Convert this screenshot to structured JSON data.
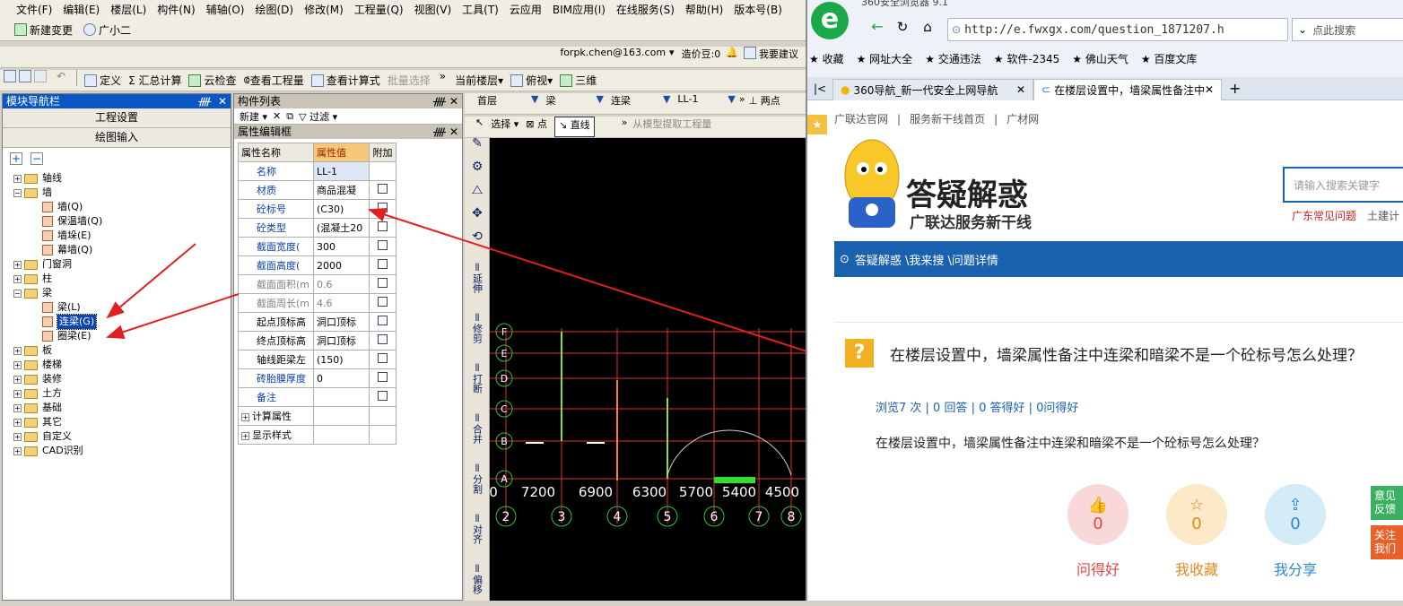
{
  "app": {
    "menu": [
      "文件(F)",
      "编辑(E)",
      "楼层(L)",
      "构件(N)",
      "辅轴(O)",
      "绘图(D)",
      "修改(M)",
      "工程量(Q)",
      "视图(V)",
      "工具(T)",
      "云应用",
      "BIM应用(I)",
      "在线服务(S)",
      "帮助(H)",
      "版本号(B)"
    ],
    "submenu": [
      "新建变更",
      "广小二"
    ],
    "account": {
      "email": "forpk.chen@163.com",
      "price": "造价豆:0",
      "suggest": "我要建议"
    },
    "toolbar1": [
      "定义",
      "Σ 汇总计算",
      "云检查",
      "查看工程量",
      "查看计算式",
      "批量选择",
      "当前楼层",
      "俯视",
      "三维"
    ],
    "nav": {
      "title": "模块导航栏",
      "btn1": "工程设置",
      "btn2": "绘图输入",
      "tree": [
        {
          "label": "轴线",
          "level": 0,
          "exp": "+"
        },
        {
          "label": "墙",
          "level": 0,
          "exp": "-"
        },
        {
          "label": "墙(Q)",
          "level": 1
        },
        {
          "label": "保温墙(Q)",
          "level": 1
        },
        {
          "label": "墙垛(E)",
          "level": 1
        },
        {
          "label": "幕墙(Q)",
          "level": 1
        },
        {
          "label": "门窗洞",
          "level": 0,
          "exp": "+"
        },
        {
          "label": "柱",
          "level": 0,
          "exp": "+"
        },
        {
          "label": "梁",
          "level": 0,
          "exp": "-"
        },
        {
          "label": "梁(L)",
          "level": 1
        },
        {
          "label": "连梁(G)",
          "level": 1,
          "sel": true
        },
        {
          "label": "圈梁(E)",
          "level": 1
        },
        {
          "label": "板",
          "level": 0,
          "exp": "+"
        },
        {
          "label": "楼梯",
          "level": 0,
          "exp": "+"
        },
        {
          "label": "装修",
          "level": 0,
          "exp": "+"
        },
        {
          "label": "土方",
          "level": 0,
          "exp": "+"
        },
        {
          "label": "基础",
          "level": 0,
          "exp": "+"
        },
        {
          "label": "其它",
          "level": 0,
          "exp": "+"
        },
        {
          "label": "自定义",
          "level": 0,
          "exp": "+"
        },
        {
          "label": "CAD识别",
          "level": 0,
          "exp": "+"
        }
      ]
    },
    "complist": {
      "title": "构件列表",
      "new": "新建",
      "filter": "过滤"
    },
    "propeditor": {
      "title": "属性编辑框",
      "headers": [
        "属性名称",
        "属性值",
        "附加"
      ],
      "rows": [
        {
          "n": "名称",
          "v": "LL-1",
          "cb": false,
          "kind": "blue"
        },
        {
          "n": "材质",
          "v": "商品混凝",
          "cb": true,
          "kind": "blue"
        },
        {
          "n": "砼标号",
          "v": "(C30)",
          "cb": true,
          "kind": "blue"
        },
        {
          "n": "砼类型",
          "v": "(混凝土20",
          "cb": true,
          "kind": "blue"
        },
        {
          "n": "截面宽度(",
          "v": "300",
          "cb": true,
          "kind": "blue"
        },
        {
          "n": "截面高度(",
          "v": "2000",
          "cb": true,
          "kind": "blue"
        },
        {
          "n": "截面面积(m",
          "v": "0.6",
          "cb": true,
          "kind": "dim"
        },
        {
          "n": "截面周长(m",
          "v": "4.6",
          "cb": true,
          "kind": "dim"
        },
        {
          "n": "起点顶标高",
          "v": "洞口顶标",
          "cb": true,
          "kind": "k"
        },
        {
          "n": "终点顶标高",
          "v": "洞口顶标",
          "cb": true,
          "kind": "k"
        },
        {
          "n": "轴线距梁左",
          "v": "(150)",
          "cb": true,
          "kind": "k"
        },
        {
          "n": "砖胎膜厚度",
          "v": "0",
          "cb": true,
          "kind": "blue"
        },
        {
          "n": "备注",
          "v": "",
          "cb": true,
          "kind": "blue"
        },
        {
          "n": "计算属性",
          "v": "",
          "cb": false,
          "kind": "k",
          "plus": true
        },
        {
          "n": "显示样式",
          "v": "",
          "cb": false,
          "kind": "k",
          "plus": true
        }
      ]
    },
    "drawbar": {
      "floor": "首层",
      "type": "梁",
      "sub": "连梁",
      "name": "LL-1",
      "twopoint": "两点",
      "select": "选择",
      "point": "点",
      "line": "直线",
      "extract": "从模型提取工程量"
    },
    "vtools": [
      "延伸",
      "修剪",
      "打断",
      "合并",
      "分割",
      "对齐",
      "偏移"
    ],
    "grid": {
      "rows": [
        "F",
        "E",
        "D",
        "C",
        "B",
        "A"
      ],
      "cols": [
        "2",
        "3",
        "4",
        "5",
        "6",
        "7",
        "8"
      ],
      "dims": [
        "0",
        "7200",
        "6900",
        "6300",
        "5700",
        "5400",
        "4500"
      ]
    }
  },
  "browser": {
    "title": "360安全浏览器 9.1",
    "url": "http://e.fwxgx.com/question_1871207.h",
    "search_ph": "点此搜索",
    "bookmarks": [
      "收藏",
      "网址大全",
      "交通违法",
      "软件-2345",
      "佛山天气",
      "百度文库"
    ],
    "tabs": [
      "360导航_新一代安全上网导航",
      "在楼层设置中，墙梁属性备注中"
    ],
    "topnav": [
      "广联达官网",
      "服务新干线首页",
      "广材网"
    ],
    "logo_title": "答疑解惑",
    "logo_sub": "广联达服务新干线",
    "site_search_ph": "请输入搜索关键字",
    "site_links": [
      "广东常见问题",
      "土建计"
    ],
    "crumb": "答疑解惑 \\我来搜 \\问题详情",
    "q_title": "在楼层设置中，墙梁属性备注中连梁和暗梁不是一个砼标号怎么处理？",
    "q_stats": "浏览7 次 | 0 回答 | 0 答得好 | 0问得好",
    "q_body": "在楼层设置中，墙梁属性备注中连梁和暗梁不是一个砼标号怎么处理？",
    "actions": [
      {
        "label": "问得好",
        "count": "0",
        "color": "#f8d8d8",
        "fg": "#e04848"
      },
      {
        "label": "我收藏",
        "count": "0",
        "color": "#fbe9c8",
        "fg": "#e08a20"
      },
      {
        "label": "我分享",
        "count": "0",
        "color": "#d4ecf8",
        "fg": "#2a8ad0"
      }
    ],
    "side": [
      "意见反馈",
      "关注我们"
    ]
  }
}
